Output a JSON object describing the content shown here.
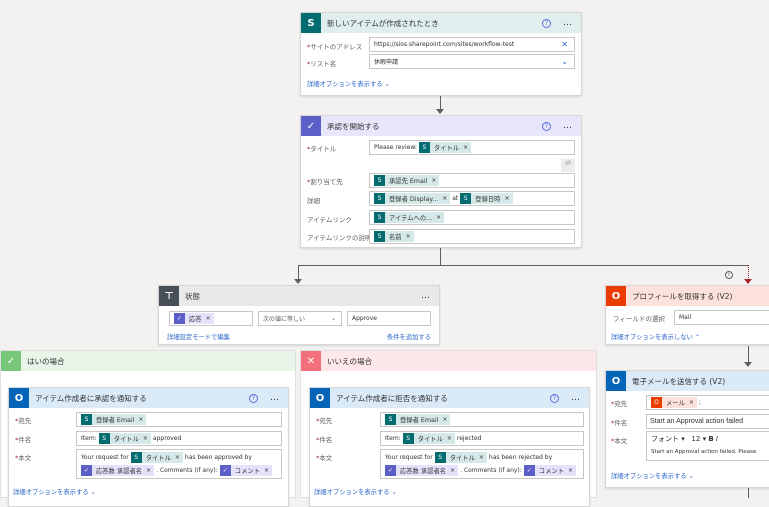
{
  "trigger": {
    "title": "新しいアイテムが作成されたとき",
    "icon": "sharepoint-icon",
    "site_label": "サイトのアドレス",
    "site_value": "https://sios.sharepoint.com/sites/workflow-test",
    "list_label": "リスト名",
    "list_value": "休暇申請",
    "advanced": "詳細オプションを表示する"
  },
  "approval": {
    "title": "承認を開始する",
    "icon": "approvals-icon",
    "title_label": "タイトル",
    "title_prefix": "Please review:",
    "title_token": "タイトル",
    "assign_label": "割り当て先",
    "assign_token": "承認先 Email",
    "details_label": "詳細",
    "details_token1": "登録者 Display...",
    "details_at": "at",
    "details_token2": "登録日時",
    "link_label": "アイテムリンク",
    "link_token": "アイテムへの...",
    "linkdesc_label": "アイテムリンクの説明",
    "linkdesc_token": "名前"
  },
  "condition": {
    "title": "状態",
    "token": "応答",
    "operator": "次の値に等しい",
    "value": "Approve",
    "edit_advanced": "詳細設定モードで編集",
    "add_condition": "条件を追加する"
  },
  "yes": {
    "title": "はいの場合",
    "action": "アイテム作成者に承認を通知する",
    "to_label": "宛先",
    "to_token": "登録者 Email",
    "subject_label": "件名",
    "subject_prefix": "Item:",
    "subject_token": "タイトル",
    "subject_suffix": "approved",
    "body_label": "本文",
    "body_prefix": "Your request for",
    "body_token": "タイトル",
    "body_mid": "has been approved by",
    "body_token2": "応答数 承認者名",
    "body_comments": ". Comments (if any):",
    "body_token3": "コメント",
    "advanced": "詳細オプションを表示する"
  },
  "no": {
    "title": "いいえの場合",
    "action": "アイテム作成者に拒否を通知する",
    "to_label": "宛先",
    "to_token": "登録者 Email",
    "subject_label": "件名",
    "subject_prefix": "Item:",
    "subject_token": "タイトル",
    "subject_suffix": "rejected",
    "body_label": "本文",
    "body_prefix": "Your request for",
    "body_token": "タイトル",
    "body_mid": "has been rejected by",
    "body_token2": "応答数 承認者名",
    "body_comments": ". Comments (if any):",
    "body_token3": "コメント",
    "advanced": "詳細オプションを表示する"
  },
  "profile": {
    "title": "プロフィールを取得する (V2)",
    "field_label": "フィールドの選択",
    "field_value": "Mail",
    "advanced": "詳細オプションを表示しない"
  },
  "email": {
    "title": "電子メールを送信する (V2)",
    "to_label": "宛先",
    "to_token": "メール",
    "subject_label": "件名",
    "subject_value": "Start an Approval action failed",
    "body_label": "本文",
    "font": "フォント",
    "size": "12",
    "body_value": "Start an Approval action failed. Please",
    "advanced": "詳細オプションを表示する"
  },
  "colors": {
    "sharepoint": "#036c70",
    "approvals": "#5b5fc7",
    "outlook": "#0364b8",
    "office": "#eb3c00",
    "yes": "#78c67a",
    "no": "#f1707b"
  }
}
